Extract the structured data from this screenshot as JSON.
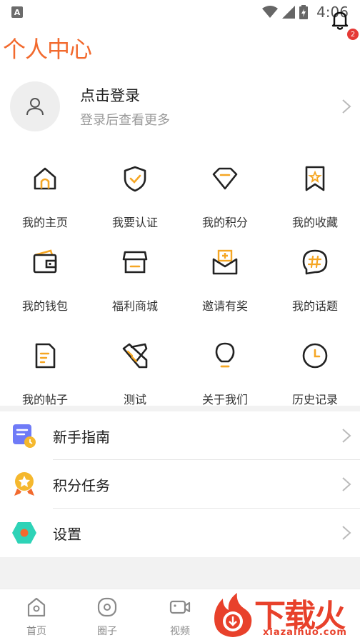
{
  "status_bar": {
    "app_indicator": "A",
    "time": "4:06"
  },
  "header": {
    "title": "个人中心",
    "notification_count": "2"
  },
  "login": {
    "title": "点击登录",
    "subtitle": "登录后查看更多"
  },
  "grid": [
    {
      "label": "我的主页",
      "icon": "home-icon"
    },
    {
      "label": "我要认证",
      "icon": "shield-check-icon"
    },
    {
      "label": "我的积分",
      "icon": "diamond-icon"
    },
    {
      "label": "我的收藏",
      "icon": "bookmark-star-icon"
    },
    {
      "label": "我的钱包",
      "icon": "wallet-icon"
    },
    {
      "label": "福利商城",
      "icon": "shop-icon"
    },
    {
      "label": "邀请有奖",
      "icon": "invite-envelope-icon"
    },
    {
      "label": "我的话题",
      "icon": "hashtag-icon"
    },
    {
      "label": "我的帖子",
      "icon": "document-icon"
    },
    {
      "label": "测试",
      "icon": "test-pen-icon"
    },
    {
      "label": "关于我们",
      "icon": "lightbulb-icon"
    },
    {
      "label": "历史记录",
      "icon": "clock-icon"
    }
  ],
  "list": [
    {
      "label": "新手指南",
      "icon": "guide-icon"
    },
    {
      "label": "积分任务",
      "icon": "medal-icon"
    },
    {
      "label": "设置",
      "icon": "settings-hexagon-icon"
    }
  ],
  "bottom_nav": [
    {
      "label": "首页",
      "icon": "home-nav-icon"
    },
    {
      "label": "圈子",
      "icon": "circle-nav-icon"
    },
    {
      "label": "视频",
      "icon": "video-nav-icon"
    }
  ],
  "watermark": {
    "text": "下载火",
    "url": "xiazaihuo.com"
  },
  "colors": {
    "accent": "#f5a623",
    "title": "#f26a2e",
    "badge": "#e53935",
    "watermark": "#e8412b"
  }
}
